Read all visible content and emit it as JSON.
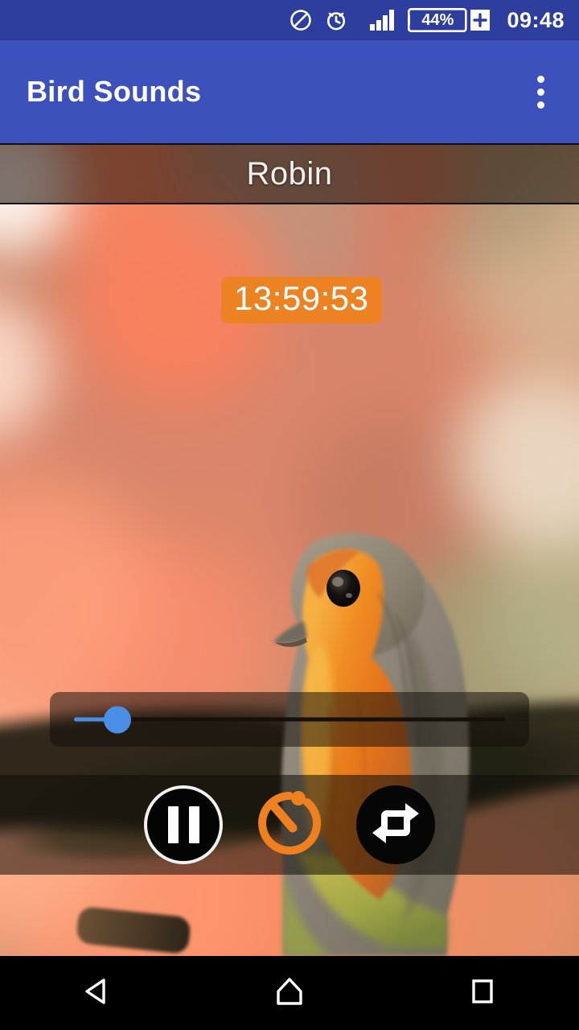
{
  "status_bar": {
    "background_color": "#2E3E9E",
    "clock": "09:48",
    "battery_percent": "44%",
    "icons": [
      {
        "name": "do-not-disturb-icon",
        "label": "Do not disturb"
      },
      {
        "name": "alarm-clock-icon",
        "label": "Alarm set"
      },
      {
        "name": "signal-bars-icon",
        "label": "Signal strength"
      },
      {
        "name": "battery-icon",
        "label": "Battery 44%"
      },
      {
        "name": "battery-plus-icon",
        "label": "Battery plus"
      }
    ]
  },
  "app_bar": {
    "title": "Bird Sounds",
    "background_color": "#3C51BC",
    "overflow_menu_label": "More options"
  },
  "player": {
    "species_name": "Robin",
    "countdown": "13:59:53",
    "countdown_color": "#ED8222",
    "seek": {
      "progress_percent": 10,
      "thumb_color": "#4B8EE8",
      "track_color": "#151008"
    },
    "controls": [
      {
        "name": "play-pause-button",
        "icon": "pause-icon",
        "label": "Pause",
        "state": "playing"
      },
      {
        "name": "sleep-timer-button",
        "icon": "timer-icon",
        "label": "Sleep timer",
        "color": "#F07F20"
      },
      {
        "name": "repeat-button",
        "icon": "repeat-icon",
        "label": "Repeat",
        "state": "on"
      }
    ]
  },
  "nav_bar": {
    "background_color": "#000000",
    "buttons": [
      {
        "name": "nav-back-button",
        "icon": "back-triangle-icon",
        "label": "Back"
      },
      {
        "name": "nav-home-button",
        "icon": "home-icon",
        "label": "Home"
      },
      {
        "name": "nav-recents-button",
        "icon": "recents-square-icon",
        "label": "Recent apps"
      }
    ]
  }
}
